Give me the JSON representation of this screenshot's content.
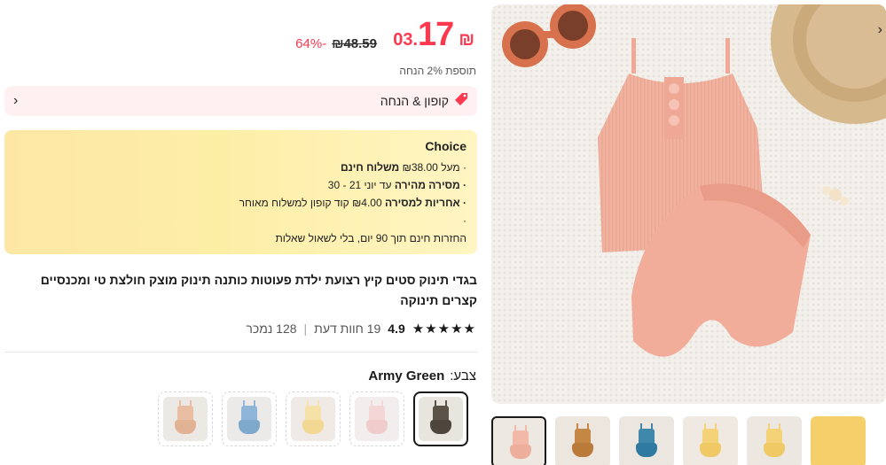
{
  "price": {
    "currency": "₪",
    "integer": "17",
    "decimal": ".03",
    "old": "₪48.59",
    "discount": "-64%",
    "extra": "תוספת 2% הנחה"
  },
  "coupon": {
    "label": "קופון & הנחה",
    "tag_icon": "tag-icon",
    "arrow_icon": "chevron-left-icon"
  },
  "choice": {
    "title": "Choice",
    "line1_prefix": "· מעל",
    "line1_amount": "₪38.00",
    "line1_bold": "משלוח חינם",
    "line2_bold": "· מסירה מהירה",
    "line2_rest": "עד יוני 21 - 30",
    "line3_bold": "· אחריות למסירה",
    "line3_rest": "₪4.00 קוד קופון למשלוח מאוחר",
    "line4": "·",
    "line5": "החזרות חינם תוך 90 יום, בלי לשאול שאלות"
  },
  "product": {
    "title": "בגדי תינוק סטים קיץ רצועת ילדת פעוטות כותנה תינוק מוצק חולצת טי ומכנסיים קצרים תינוקה",
    "stars": "★★★★★",
    "rating": "4.9",
    "reviews": "19 חוות דעת",
    "separator": "|",
    "sold": "128 נמכר"
  },
  "color": {
    "label": "צבע:",
    "value": "Army Green"
  },
  "swatches": [
    {
      "name": "army-green",
      "top": "#5b5248",
      "bottom": "#4e463d",
      "bg": "#e8e4de"
    },
    {
      "name": "pink",
      "top": "#f4d6d6",
      "bottom": "#f0cccc",
      "bg": "#f3eeee"
    },
    {
      "name": "yellow",
      "top": "#f6e1a8",
      "bottom": "#f3d894",
      "bg": "#efeae6"
    },
    {
      "name": "blue",
      "top": "#8fb6d8",
      "bottom": "#7ea8cc",
      "bg": "#eceae8"
    },
    {
      "name": "peach",
      "top": "#e9bea3",
      "bottom": "#e2b295",
      "bg": "#ece8e4"
    }
  ],
  "thumbnails": [
    {
      "name": "pink",
      "top": "#f2b8a8",
      "bottom": "#eeae9c",
      "bg": "#eee8e2"
    },
    {
      "name": "brown",
      "top": "#c58744",
      "bottom": "#b97a3a",
      "bg": "#ece6df"
    },
    {
      "name": "blue",
      "top": "#3f87ab",
      "bottom": "#2f7aa0",
      "bg": "#ebe6e0"
    },
    {
      "name": "yellow",
      "top": "#f4d278",
      "bottom": "#f0c964",
      "bg": "#efe9e2"
    },
    {
      "name": "yellow-2",
      "top": "#f4d278",
      "bottom": "#f0c964",
      "bg": "#ede7e1"
    },
    {
      "name": "yellow-close",
      "top": "#f5d06a",
      "bottom": "#f5d06a",
      "bg": "#f5d06a"
    }
  ],
  "gallery_next_icon": "chevron-right-icon"
}
